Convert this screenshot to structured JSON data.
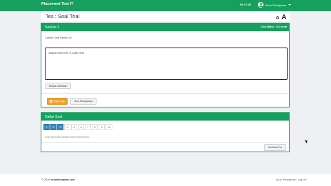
{
  "colors": {
    "brand_green": "#16a05d",
    "answered_blue": "#3a87c0",
    "warning_orange": "#f0a030"
  },
  "topbar": {
    "brand": "Placement Test IT",
    "clock": "00:17:30",
    "user_name": "Akun Peninjauan"
  },
  "header": {
    "title": "Tes : Soal Trial",
    "font_small": "A",
    "font_large": "A"
  },
  "question_panel": {
    "title": "Soal ke-1",
    "time_left": "Sisa Waktu : 114 menit",
    "question_text": "Contoh Soal Nomor 10",
    "answer_value": "Jawaban soal nomor 11 sudah benar",
    "save_button": "Simpan Jawaban",
    "doubt_button": "Ragu-ragu",
    "next_button": "Soal Selanjutnya"
  },
  "question_list": {
    "title": "Daftar Soal",
    "numbers": [
      {
        "label": "1",
        "answered": true
      },
      {
        "label": "2",
        "answered": true
      },
      {
        "label": "3",
        "answered": true
      },
      {
        "label": "4",
        "answered": false
      },
      {
        "label": "5",
        "answered": false
      },
      {
        "label": "6",
        "answered": false
      },
      {
        "label": "7",
        "answered": false
      },
      {
        "label": "8",
        "answered": false
      },
      {
        "label": "9",
        "answered": false
      },
      {
        "label": "10",
        "answered": false
      }
    ],
    "legend": "Soal yang sudah dijawab akan berwarna Biru.",
    "finish_button": "Hentikan Tes"
  },
  "footer": {
    "copyright_prefix": "© 2019",
    "copyright_site": "sekolahimplan.com",
    "user_link": "Akun Peninjauan",
    "separator": "|",
    "logout_link": "Log out"
  }
}
